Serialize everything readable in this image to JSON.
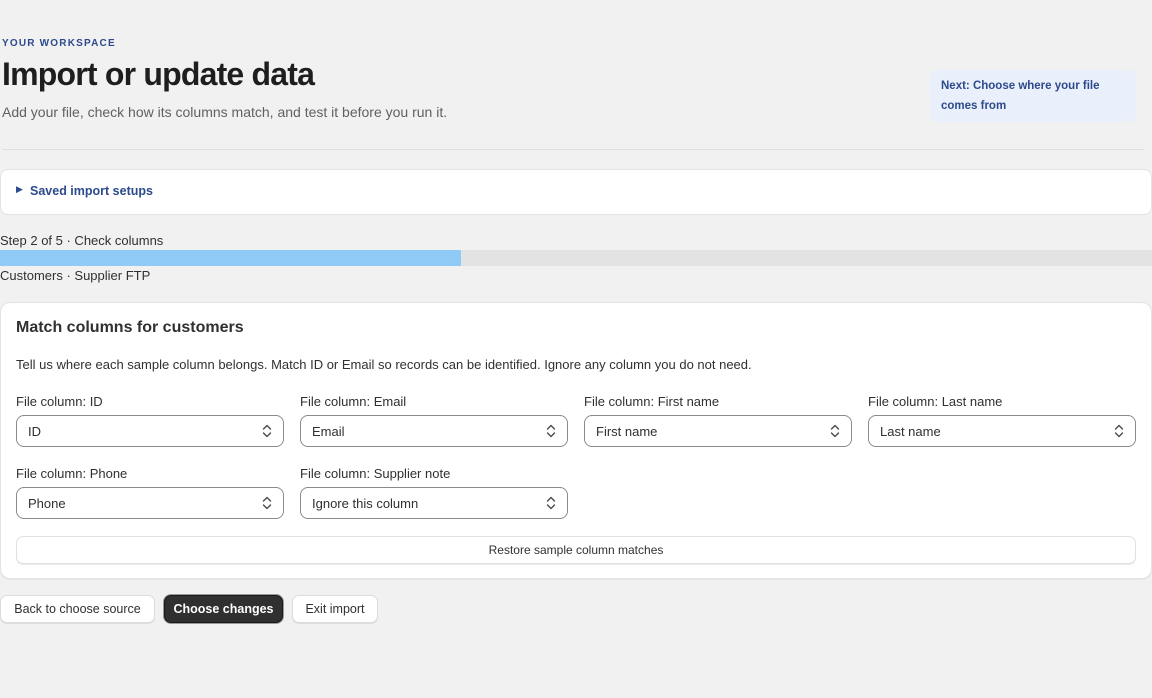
{
  "header": {
    "eyebrow": "YOUR WORKSPACE",
    "title": "Import or update data",
    "subtitle": "Add your file, check how its columns match, and test it before you run it.",
    "next_hint": "Next: Choose where your file comes from"
  },
  "saved_setups": {
    "label": "Saved import setups",
    "icon": "disclosure-triangle-right"
  },
  "progress": {
    "step_label": "Step 2 of 5 · Check columns",
    "fraction": 0.4,
    "source_label": "Customers · Supplier FTP",
    "fill_color": "#8fcbf6"
  },
  "card": {
    "title": "Match columns for customers",
    "description": "Tell us where each sample column belongs. Match ID or Email so records can be identified. Ignore any column you do not need.",
    "fields": [
      {
        "label": "File column: ID",
        "value": "ID"
      },
      {
        "label": "File column: Email",
        "value": "Email"
      },
      {
        "label": "File column: First name",
        "value": "First name"
      },
      {
        "label": "File column: Last name",
        "value": "Last name"
      },
      {
        "label": "File column: Phone",
        "value": "Phone"
      },
      {
        "label": "File column: Supplier note",
        "value": "Ignore this column"
      }
    ],
    "restore_label": "Restore sample column matches"
  },
  "footer": {
    "back_label": "Back to choose source",
    "primary_label": "Choose changes",
    "exit_label": "Exit import"
  },
  "colors": {
    "accent": "#2c4a8c",
    "primary_button": "#303030",
    "background": "#f1f1f1"
  }
}
